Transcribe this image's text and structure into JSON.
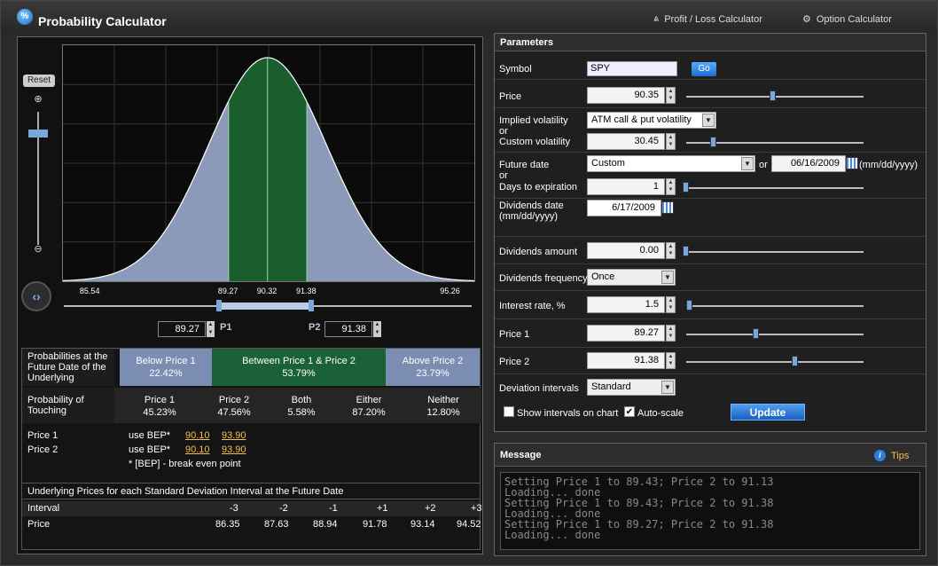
{
  "app": {
    "logo_symbol": "%",
    "title": "Probability Calculator",
    "links": [
      {
        "label": "Profit / Loss Calculator",
        "icon": "pl-calculator-icon"
      },
      {
        "label": "Option Calculator",
        "icon": "option-calculator-icon"
      }
    ]
  },
  "chart": {
    "reset_label": "Reset",
    "x_tick_labels": [
      "85.54",
      "89.27",
      "90.32",
      "91.38",
      "95.26"
    ],
    "p1_value": "89.27",
    "p2_value": "91.38",
    "p1_label": "P1",
    "p2_label": "P2",
    "colors": {
      "tail": "#8a9ab8",
      "middle": "#1a5e2e",
      "curve": "#ffffff"
    },
    "chart_data": {
      "type": "area",
      "x_range": [
        84.8,
        95.9
      ],
      "mean": 90.32,
      "sd": 1.6,
      "band": [
        89.27,
        91.38
      ],
      "ticks": [
        85.54,
        89.27,
        90.32,
        91.38,
        95.26
      ]
    }
  },
  "probabilities": {
    "future_header": "Probabilities at the Future Date of the Underlying",
    "below": {
      "label": "Below Price 1",
      "value": "22.42%"
    },
    "between": {
      "label": "Between Price 1 & Price 2",
      "value": "53.79%"
    },
    "above": {
      "label": "Above Price 2",
      "value": "23.79%"
    },
    "touch_header": "Probability of Touching",
    "touch": [
      {
        "label": "Price 1",
        "value": "45.23%"
      },
      {
        "label": "Price 2",
        "value": "47.56%"
      },
      {
        "label": "Both",
        "value": "5.58%"
      },
      {
        "label": "Either",
        "value": "87.20%"
      },
      {
        "label": "Neither",
        "value": "12.80%"
      }
    ],
    "bep": {
      "price1_label": "Price 1",
      "price2_label": "Price 2",
      "use_bep": "use BEP*",
      "p1_a": "90.10",
      "p1_b": "93.90",
      "p2_a": "90.10",
      "p2_b": "93.90",
      "note": "* [BEP] - break even point"
    }
  },
  "sd_table": {
    "header": "Underlying Prices for each Standard Deviation Interval at the Future Date",
    "interval_label": "Interval",
    "price_label": "Price",
    "intervals": [
      "-3",
      "-2",
      "-1",
      "+1",
      "+2",
      "+3"
    ],
    "prices": [
      "86.35",
      "87.63",
      "88.94",
      "91.78",
      "93.14",
      "94.52"
    ]
  },
  "params": {
    "header": "Parameters",
    "symbol_label": "Symbol",
    "symbol_value": "SPY",
    "go_label": "Go",
    "price_label": "Price",
    "price_value": "90.35",
    "iv_label_1": "Implied volatility",
    "or": "or",
    "iv_label_2": "Custom volatility",
    "iv_select": "ATM call & put volatility",
    "cv_value": "30.45",
    "future_label": "Future date",
    "future_select": "Custom",
    "future_or": "or",
    "future_date": "06/16/2009",
    "date_format": "(mm/dd/yyyy)",
    "days_label": "Days to expiration",
    "days_value": "1",
    "div_date_label_1": "Dividends date",
    "div_date_label_2": "(mm/dd/yyyy)",
    "div_date_value": "6/17/2009",
    "div_amount_label": "Dividends amount",
    "div_amount_value": "0.00",
    "div_freq_label": "Dividends frequency",
    "div_freq_value": "Once",
    "rate_label": "Interest rate, %",
    "rate_value": "1.5",
    "price1_label": "Price 1",
    "price1_value": "89.27",
    "price2_label": "Price 2",
    "price2_value": "91.38",
    "dev_label": "Deviation intervals",
    "dev_value": "Standard",
    "show_intervals_label": "Show intervals on chart",
    "show_intervals_checked": false,
    "autoscale_label": "Auto-scale",
    "autoscale_checked": true,
    "update_label": "Update"
  },
  "message": {
    "header": "Message",
    "tips_label": "Tips",
    "lines": [
      "Setting Price 1 to 89.43; Price 2 to 91.13",
      "Loading... done",
      "Setting Price 1 to 89.43; Price 2 to 91.38",
      "Loading... done",
      "Setting Price 1 to 89.27; Price 2 to 91.38",
      "Loading... done"
    ]
  }
}
